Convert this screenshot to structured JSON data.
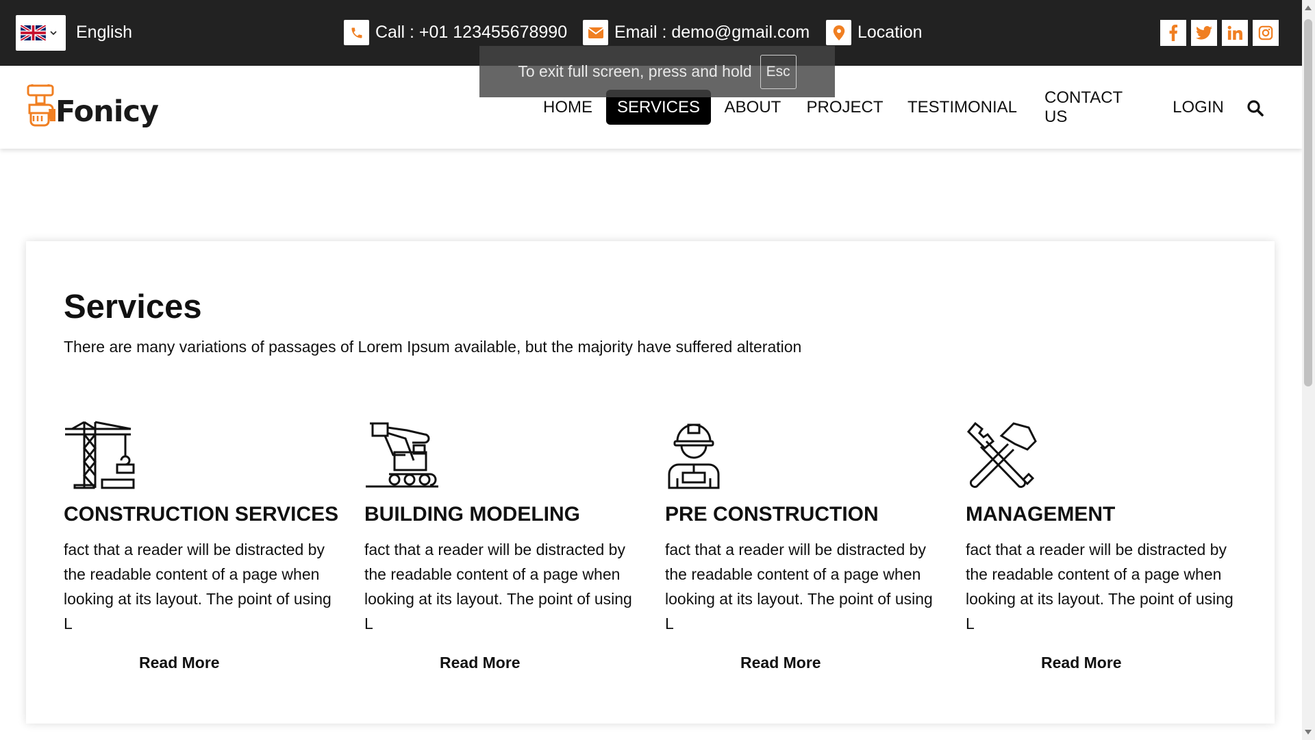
{
  "topbar": {
    "language": "English",
    "phone": "Call : +01 123455678990",
    "email": "Email : demo@gmail.com",
    "location": "Location",
    "socials": [
      "facebook-icon",
      "twitter-icon",
      "linkedin-icon",
      "instagram-icon"
    ]
  },
  "toast": {
    "message": "To exit full screen, press and hold",
    "key": "Esc"
  },
  "brand": {
    "name": "Fonicy",
    "accent": "#f07f22"
  },
  "nav": {
    "items": [
      "HOME",
      "SERVICES",
      "ABOUT",
      "PROJECT",
      "TESTIMONIAL",
      "CONTACT US",
      "LOGIN"
    ],
    "active": "SERVICES"
  },
  "services": {
    "title": "Services",
    "subtitle": "There are many variations of passages of Lorem Ipsum available, but the majority have suffered alteration",
    "items": [
      {
        "icon": "crane-icon",
        "title": "CONSTRUCTION SERVICES",
        "text": "fact that a reader will be distracted by the readable content of a page when looking at its layout. The point of using L",
        "link": "Read More"
      },
      {
        "icon": "excavator-icon",
        "title": "BUILDING MODELING",
        "text": "fact that a reader will be distracted by the readable content of a page when looking at its layout. The point of using L",
        "link": "Read More"
      },
      {
        "icon": "worker-icon",
        "title": "PRE CONSTRUCTION",
        "text": "fact that a reader will be distracted by the readable content of a page when looking at its layout. The point of using L",
        "link": "Read More"
      },
      {
        "icon": "tools-icon",
        "title": "MANAGEMENT",
        "text": "fact that a reader will be distracted by the readable content of a page when looking at its layout. The point of using L",
        "link": "Read More"
      }
    ]
  }
}
